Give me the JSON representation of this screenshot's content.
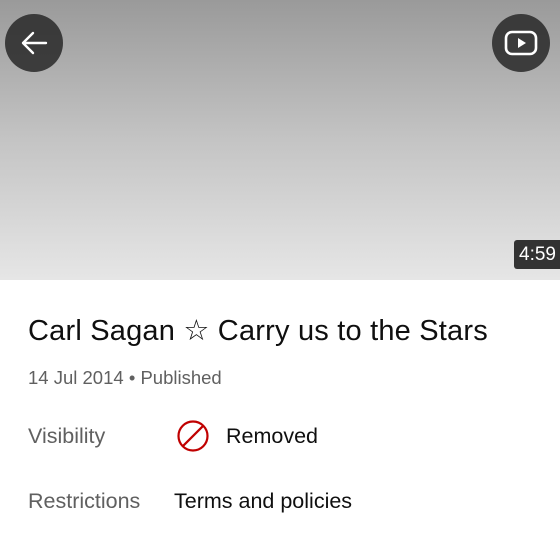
{
  "video": {
    "duration": "4:59",
    "title": "Carl Sagan ☆ Carry us to the Stars",
    "date": "14 Jul 2014",
    "separator": "•",
    "status": "Published"
  },
  "header": {
    "back_icon": "arrow-left-icon",
    "play_icon": "youtube-play-icon"
  },
  "visibility": {
    "label": "Visibility",
    "value": "Removed",
    "icon": "prohibited-icon",
    "icon_color": "#c00000"
  },
  "restrictions": {
    "label": "Restrictions",
    "value": "Terms and policies"
  }
}
